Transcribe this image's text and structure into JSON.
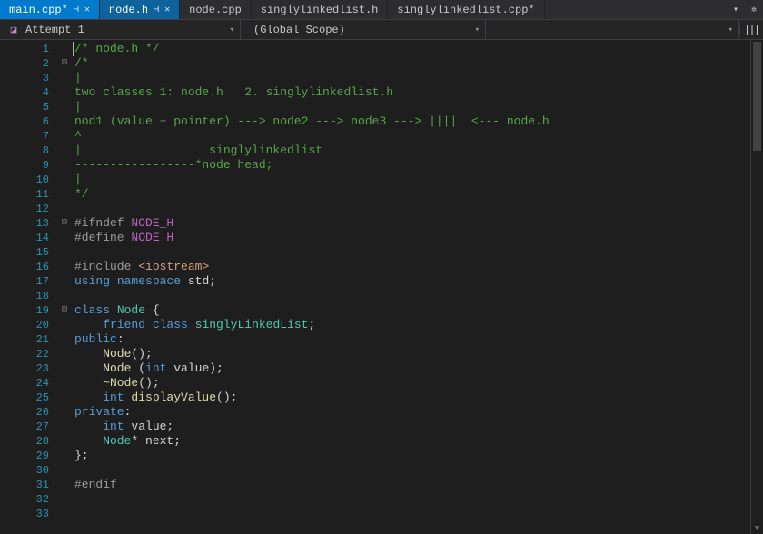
{
  "tabs": [
    {
      "label": "main.cpp*",
      "pinned": true,
      "close": true,
      "state": "active"
    },
    {
      "label": "node.h",
      "pinned": true,
      "close": true,
      "state": "current"
    },
    {
      "label": "node.cpp",
      "pinned": false,
      "close": false,
      "state": ""
    },
    {
      "label": "singlylinkedlist.h",
      "pinned": false,
      "close": false,
      "state": ""
    },
    {
      "label": "singlylinkedlist.cpp*",
      "pinned": false,
      "close": false,
      "state": ""
    }
  ],
  "context": {
    "nav1": "Attempt 1",
    "nav2": "(Global Scope)",
    "nav3": ""
  },
  "line_count": 33,
  "fold_markers": {
    "2": true,
    "13": true,
    "19": true
  },
  "code": {
    "l1": "/* node.h */",
    "l2": "/*",
    "l3": "|",
    "l4": "two classes 1: node.h   2. singlylinkedlist.h",
    "l5": "|",
    "l6": "nod1 (value + pointer) ---> node2 ---> node3 ---> ||||  <--- node.h",
    "l7": "^",
    "l8": "|                  singlylinkedlist",
    "l9": "-----------------*node head;",
    "l10": "|",
    "l11": "*/",
    "l12": "",
    "l13a": "#ifndef",
    "l13b": "NODE_H",
    "l14a": "#define",
    "l14b": "NODE_H",
    "l15": "",
    "l16a": "#include",
    "l16b": "<iostream>",
    "l17a": "using",
    "l17b": "namespace",
    "l17c": "std",
    "l17d": ";",
    "l18": "",
    "l19a": "class",
    "l19b": "Node",
    "l19c": " {",
    "l20a": "    friend",
    "l20b": "class",
    "l20c": "singlyLinkedList",
    "l20d": ";",
    "l21a": "public",
    "l21b": ":",
    "l22a": "    Node",
    "l22b": "();",
    "l23a": "    Node",
    "l23b": " (",
    "l23c": "int",
    "l23d": " value);",
    "l24a": "    ~Node",
    "l24b": "();",
    "l25a": "    int",
    "l25b": "displayValue",
    "l25c": "();",
    "l26a": "private",
    "l26b": ":",
    "l27a": "    int",
    "l27b": " value;",
    "l28a": "    Node",
    "l28b": "* next;",
    "l29": "};",
    "l30": "",
    "l31": "#endif",
    "l32": "",
    "l33": ""
  }
}
